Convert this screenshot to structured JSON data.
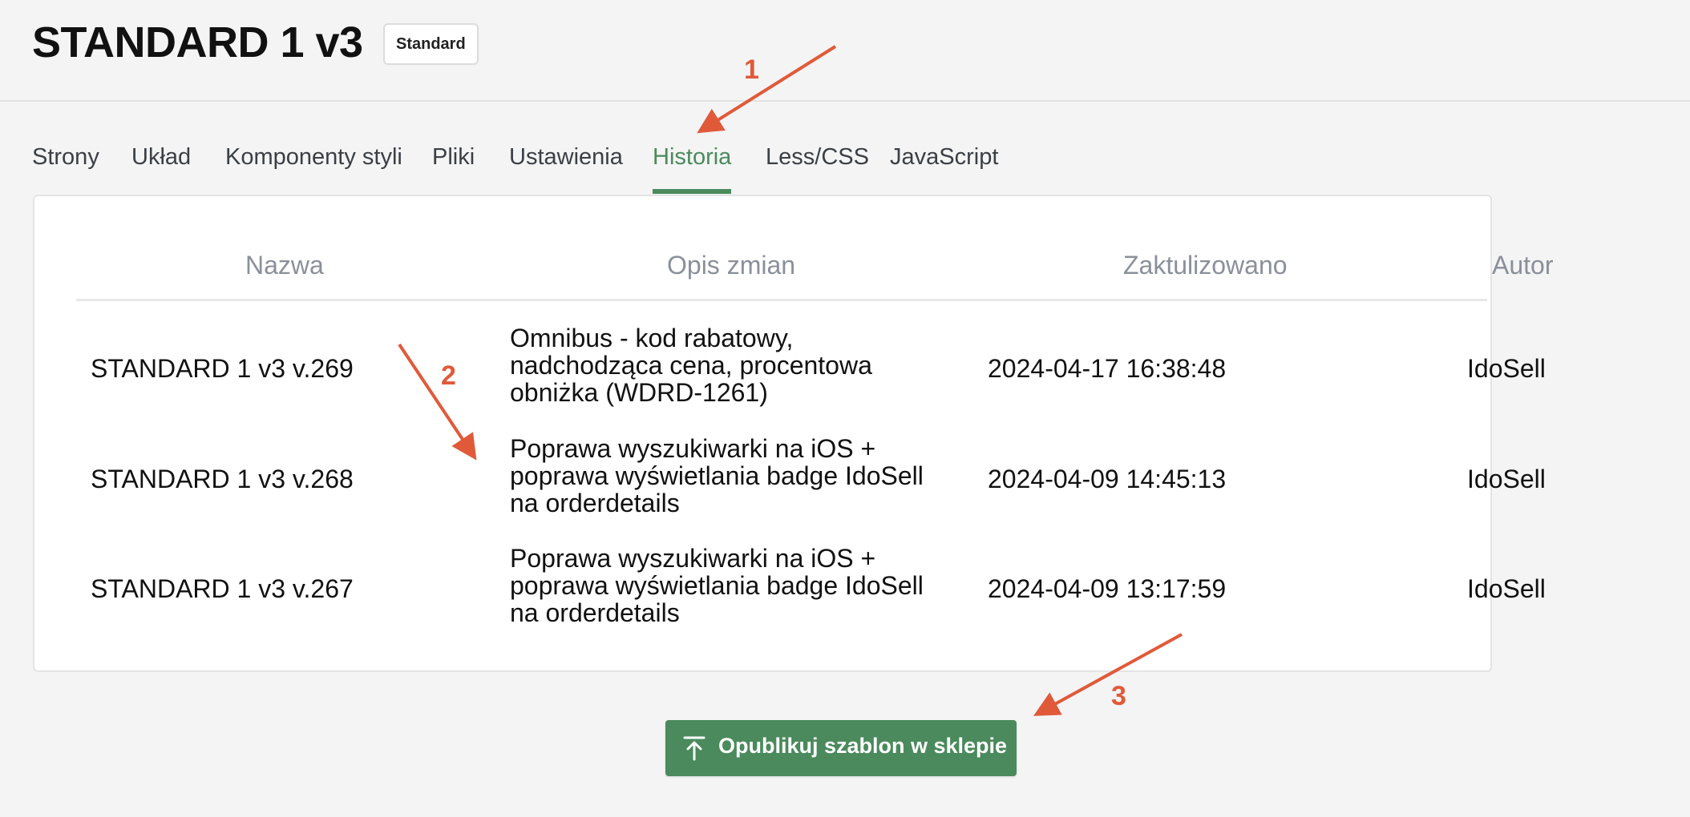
{
  "header": {
    "title": "STANDARD 1 v3",
    "badge": "Standard"
  },
  "tabs": [
    {
      "label": "Strony"
    },
    {
      "label": "Układ"
    },
    {
      "label": "Komponenty styli"
    },
    {
      "label": "Pliki"
    },
    {
      "label": "Ustawienia"
    },
    {
      "label": "Historia",
      "active": true
    },
    {
      "label": "Less/CSS"
    },
    {
      "label": "JavaScript"
    }
  ],
  "table": {
    "columns": [
      "Nazwa",
      "Opis zmian",
      "Zaktulizowano",
      "Autor"
    ],
    "rows": [
      {
        "name": "STANDARD 1 v3 v.269",
        "description": [
          "Omnibus - kod rabatowy,",
          "nadchodząca cena, procentowa",
          "obniżka (WDRD-1261)"
        ],
        "updated": "2024-04-17 16:38:48",
        "author": "IdoSell"
      },
      {
        "name": "STANDARD 1 v3 v.268",
        "description": [
          "Poprawa wyszukiwarki na iOS +",
          "poprawa wyświetlania badge IdoSell",
          "na orderdetails"
        ],
        "updated": "2024-04-09 14:45:13",
        "author": "IdoSell"
      },
      {
        "name": "STANDARD 1 v3 v.267",
        "description": [
          "Poprawa wyszukiwarki na iOS +",
          "poprawa wyświetlania badge IdoSell",
          "na orderdetails"
        ],
        "updated": "2024-04-09 13:17:59",
        "author": "IdoSell"
      }
    ]
  },
  "publish_button": {
    "label": "Opublikuj szablon w sklepie",
    "icon": "upload-icon"
  },
  "annotations": [
    {
      "number": "1"
    },
    {
      "number": "2"
    },
    {
      "number": "3"
    }
  ],
  "colors": {
    "accent": "#4a8a5c",
    "annotation": "#e05a3a"
  }
}
